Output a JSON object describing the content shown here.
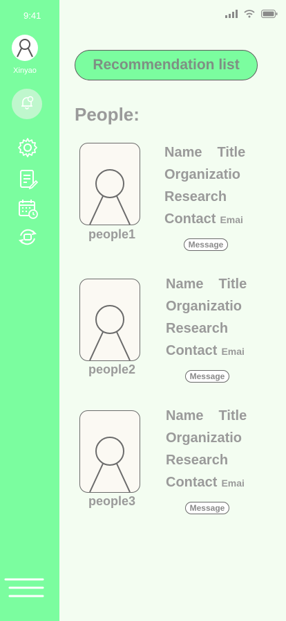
{
  "status_bar": {
    "time": "9:41"
  },
  "sidebar": {
    "username": "Xinyao",
    "icons": [
      "bell-icon",
      "gear-icon",
      "document-edit-icon",
      "calendar-clock-icon",
      "sync-icon",
      "menu-icon"
    ]
  },
  "main": {
    "recommend_button": "Recommendation list",
    "section_title": "People:",
    "people": [
      {
        "name": "people1",
        "name_label": "Name",
        "title_label": "Title",
        "organization": "Organizatio",
        "research": "Research",
        "contact": "Contact",
        "email": "Emai",
        "message": "Message"
      },
      {
        "name": "people2",
        "name_label": "Name",
        "title_label": "Title",
        "organization": "Organizatio",
        "research": "Research",
        "contact": "Contact",
        "email": "Emai",
        "message": "Message"
      },
      {
        "name": "people3",
        "name_label": "Name",
        "title_label": "Title",
        "organization": "Organizatio",
        "research": "Research",
        "contact": "Contact",
        "email": "Emai",
        "message": "Message"
      }
    ]
  },
  "colors": {
    "sidebar": "#7bfd9f",
    "background": "#f3fdf1",
    "text": "#9a9a9a"
  }
}
